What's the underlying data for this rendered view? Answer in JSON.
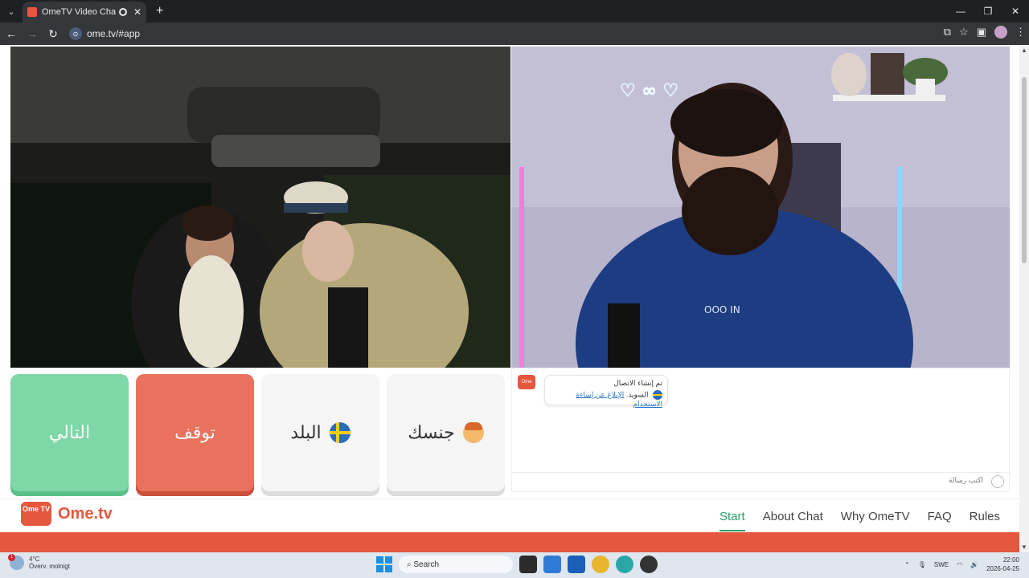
{
  "browser": {
    "tab_title": "OmeTV Video Chat — Ome",
    "url": "ome.tv/#app"
  },
  "controls": {
    "next_label": "التالي",
    "stop_label": "توقف",
    "country_label": "البلد",
    "gender_label": "جنسك"
  },
  "chat": {
    "system_message": "تم إنشاء الاتصال",
    "country_name": "السويد",
    "report_link": "الإبلاغ عن إساءة الاستخدام",
    "input_placeholder": "اكتب رسالة"
  },
  "footer": {
    "logo_tv": "Ome TV",
    "logo_text": "Ome.tv",
    "nav": [
      "Start",
      "About Chat",
      "Why OmeTV",
      "FAQ",
      "Rules"
    ],
    "active_index": 0
  },
  "taskbar": {
    "temperature": "4°C",
    "weather_text": "Överv. molnigt",
    "weather_badge": "1",
    "search_label": "Search",
    "language": "SWE",
    "time": "22:00",
    "date": "2026-04-25"
  },
  "colors": {
    "brand": "#e5573e",
    "next_green": "#7fd6a6",
    "stop_red": "#e8725d",
    "active_nav": "#2f9d66"
  },
  "icons": [
    "search-icon",
    "sweden-flag-icon",
    "boy-emoji-icon",
    "smiley-icon",
    "windows-start-icon"
  ]
}
